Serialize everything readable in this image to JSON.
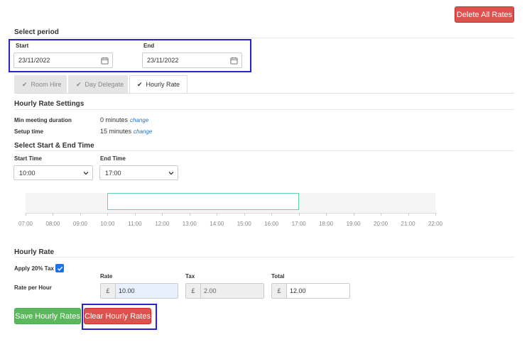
{
  "header": {
    "delete_all": "Delete All Rates"
  },
  "period": {
    "title": "Select period",
    "start_label": "Start",
    "start_value": "23/11/2022",
    "end_label": "End",
    "end_value": "23/11/2022"
  },
  "tabs": [
    {
      "label": "Room Hire",
      "active": false
    },
    {
      "label": "Day Delegate",
      "active": false
    },
    {
      "label": "Hourly Rate",
      "active": true
    }
  ],
  "settings": {
    "title": "Hourly Rate Settings",
    "min_label": "Min meeting duration",
    "min_value": "0 minutes",
    "setup_label": "Setup time",
    "setup_value": "15 minutes",
    "change_link": "change"
  },
  "times": {
    "title": "Select Start & End Time",
    "start_label": "Start Time",
    "start_value": "10:00",
    "end_label": "End Time",
    "end_value": "17:00"
  },
  "timeline": {
    "ticks": [
      "07:00",
      "08:00",
      "09:00",
      "10:00",
      "11:00",
      "12:00",
      "13:00",
      "14:00",
      "15:00",
      "16:00",
      "17:00",
      "18:00",
      "19:00",
      "20:00",
      "21:00",
      "22:00"
    ],
    "range_start": "10:00",
    "range_end": "17:00",
    "range_color": "#5fd3a9"
  },
  "rate": {
    "title": "Hourly Rate",
    "apply_tax_label": "Apply 20% Tax",
    "apply_tax_checked": true,
    "per_hour_label": "Rate per Hour",
    "currency": "£",
    "rate_label": "Rate",
    "rate_value": "10.00",
    "tax_label": "Tax",
    "tax_value": "2.00",
    "total_label": "Total",
    "total_value": "12.00"
  },
  "actions": {
    "save": "Save Hourly Rates",
    "clear": "Clear Hourly Rates"
  },
  "colors": {
    "danger": "#d9534f",
    "success": "#5cb85c",
    "highlight": "#2a23c9",
    "link": "#2a6fb5"
  }
}
